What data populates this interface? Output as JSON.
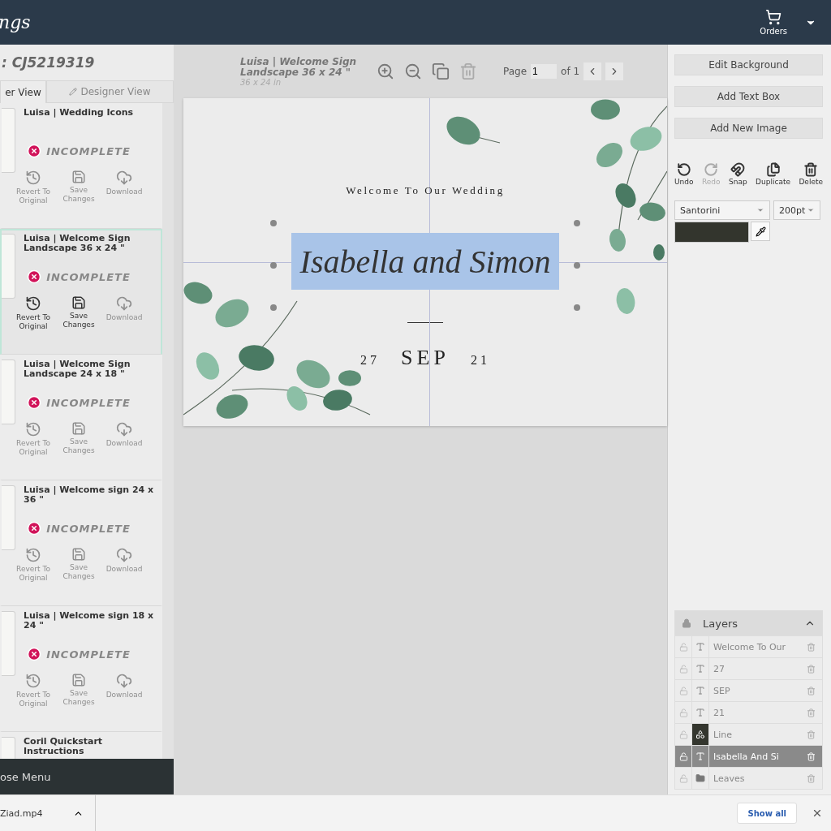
{
  "header": {
    "logo": "ngs",
    "orders": "Orders"
  },
  "sidebar": {
    "order_id": ": CJ5219319",
    "tabs": [
      {
        "label": "er View",
        "selected": true
      },
      {
        "label": "Designer View",
        "selected": false
      }
    ],
    "products": [
      {
        "title": "Luisa | Wedding Icons",
        "status": "INCOMPLETE",
        "selected": false,
        "actions": [
          {
            "kind": "revert",
            "label": "Revert To Original",
            "enabled": false
          },
          {
            "kind": "save",
            "label": "Save Changes",
            "enabled": false
          },
          {
            "kind": "download",
            "label": "Download",
            "enabled": false
          }
        ]
      },
      {
        "title": "Luisa | Welcome Sign Landscape 36 x 24 \"",
        "status": "INCOMPLETE",
        "selected": true,
        "actions": [
          {
            "kind": "revert",
            "label": "Revert To Original",
            "enabled": true
          },
          {
            "kind": "save",
            "label": "Save Changes",
            "enabled": true
          },
          {
            "kind": "download",
            "label": "Download",
            "enabled": false
          }
        ]
      },
      {
        "title": "Luisa | Welcome Sign Landscape 24 x 18 \"",
        "status": "INCOMPLETE",
        "selected": false,
        "actions": [
          {
            "kind": "revert",
            "label": "Revert To Original",
            "enabled": false
          },
          {
            "kind": "save",
            "label": "Save Changes",
            "enabled": false
          },
          {
            "kind": "download",
            "label": "Download",
            "enabled": false
          }
        ]
      },
      {
        "title": "Luisa | Welcome sign 24 x 36 \"",
        "status": "INCOMPLETE",
        "selected": false,
        "actions": [
          {
            "kind": "revert",
            "label": "Revert To Original",
            "enabled": false
          },
          {
            "kind": "save",
            "label": "Save Changes",
            "enabled": false
          },
          {
            "kind": "download",
            "label": "Download",
            "enabled": false
          }
        ]
      },
      {
        "title": "Luisa | Welcome sign 18 x 24 \"",
        "status": "INCOMPLETE",
        "selected": false,
        "actions": [
          {
            "kind": "revert",
            "label": "Revert To Original",
            "enabled": false
          },
          {
            "kind": "save",
            "label": "Save Changes",
            "enabled": false
          },
          {
            "kind": "download",
            "label": "Download",
            "enabled": false
          }
        ]
      }
    ],
    "cut_off_product": "Coril Quickstart Instructions",
    "close_menu": "ose Menu"
  },
  "canvas": {
    "title": "Luisa | Welcome Sign Landscape 36 x 24 \"",
    "size": "36 x 24 in",
    "tools": [
      {
        "kind": "zoom-in",
        "disabled": false
      },
      {
        "kind": "zoom-out",
        "disabled": false
      },
      {
        "kind": "copy",
        "disabled": false
      },
      {
        "kind": "delete",
        "disabled": true
      }
    ],
    "page_label": "Page",
    "page": "1",
    "page_total": "of 1",
    "sign": {
      "welcome": "Welcome To Our Wedding",
      "names": "Isabella and Simon",
      "day": "27",
      "month": "SEP",
      "year": "21"
    }
  },
  "panel": {
    "buttons": [
      "Edit Background",
      "Add Text Box",
      "Add New Image"
    ],
    "tools": [
      {
        "kind": "undo",
        "label": "Undo",
        "disabled": false
      },
      {
        "kind": "redo",
        "label": "Redo",
        "disabled": true
      },
      {
        "kind": "snap",
        "label": "Snap",
        "disabled": false
      },
      {
        "kind": "duplicate",
        "label": "Duplicate",
        "disabled": false
      },
      {
        "kind": "delete",
        "label": "Delete",
        "disabled": false
      }
    ],
    "font": "Santorini",
    "font_size": "200pt",
    "color": "#33352d",
    "layers": {
      "title": "Layers",
      "items": [
        {
          "kind": "text",
          "name": "Welcome To Our",
          "selected": false
        },
        {
          "kind": "text",
          "name": "27",
          "selected": false
        },
        {
          "kind": "text",
          "name": "SEP",
          "selected": false
        },
        {
          "kind": "text",
          "name": "21",
          "selected": false
        },
        {
          "kind": "shape",
          "name": "Line",
          "selected": false
        },
        {
          "kind": "text",
          "name": "Isabella And Si",
          "selected": true
        },
        {
          "kind": "folder",
          "name": "Leaves",
          "selected": false
        }
      ]
    }
  },
  "download_bar": {
    "file": "Ziad.mp4",
    "show_all": "Show all"
  }
}
